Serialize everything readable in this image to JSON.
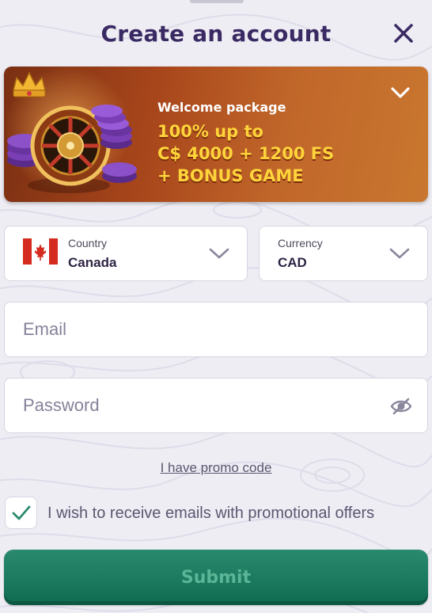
{
  "header": {
    "title": "Create an account"
  },
  "banner": {
    "subtitle": "Welcome package",
    "offer_line1": "100% up to",
    "offer_line2": "C$ 4000 + 1200 FS",
    "offer_line3": "+ BONUS GAME"
  },
  "country": {
    "label": "Country",
    "value": "Canada"
  },
  "currency": {
    "label": "Currency",
    "value": "CAD"
  },
  "email": {
    "placeholder": "Email",
    "value": ""
  },
  "password": {
    "placeholder": "Password",
    "value": ""
  },
  "promo": {
    "label": "I have promo code"
  },
  "consent": {
    "label": "I wish to receive emails with promotional offers",
    "checked": true
  },
  "submit": {
    "label": "Submit"
  },
  "colors": {
    "title": "#3a2a63",
    "banner_offer": "#ffd43b",
    "check": "#2a8a6e",
    "submit_bg": "#1c7a5e",
    "submit_text": "#5bb597"
  },
  "icons": {
    "close": "close-icon",
    "banner_toggle": "chevron-down-icon",
    "select": "chevron-down-icon",
    "password_toggle": "eye-slash-icon",
    "consent": "checkmark-icon",
    "flag": "canada-flag-icon"
  }
}
